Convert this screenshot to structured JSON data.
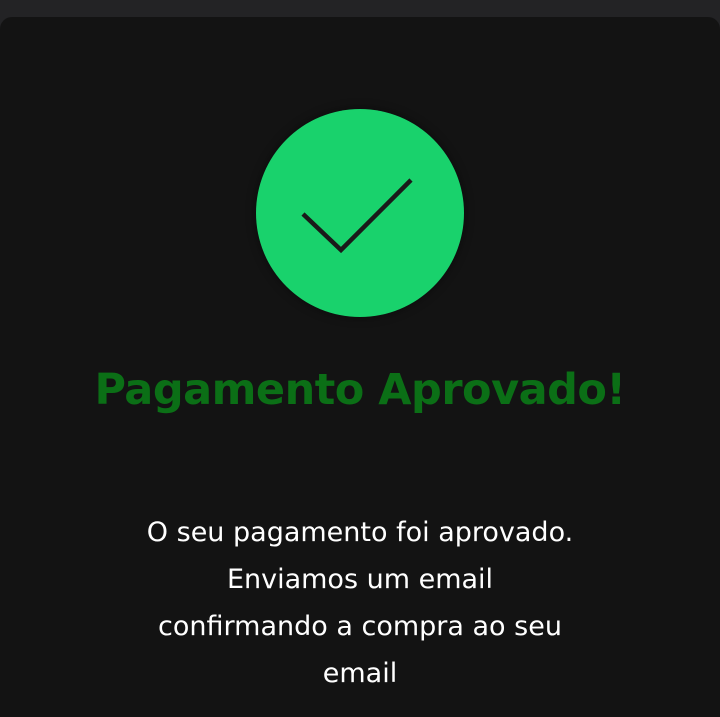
{
  "status": {
    "icon": "check-icon",
    "icon_color": "#19d26c",
    "title": "Pagamento Aprovado!",
    "title_color": "#0b6f16",
    "message_lines": [
      "O seu pagamento foi aprovado.",
      "Enviamos um email",
      "confirmando a compra ao seu",
      "email"
    ]
  }
}
